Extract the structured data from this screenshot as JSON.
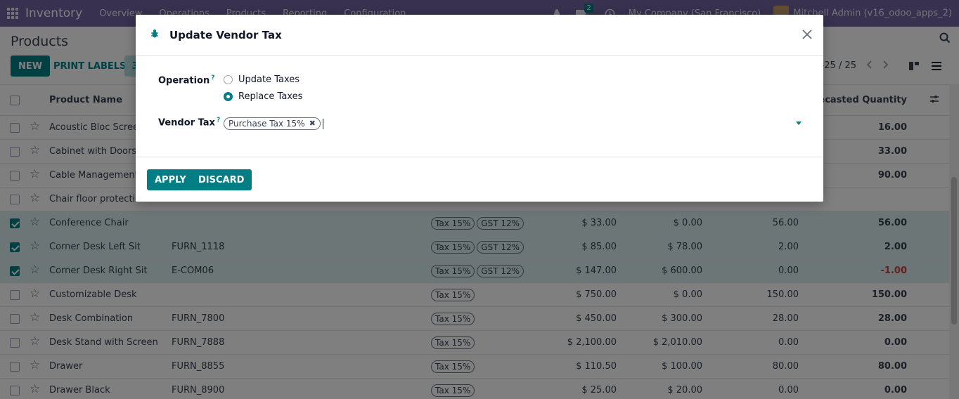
{
  "navbar": {
    "brand": "Inventory",
    "menus": [
      "Overview",
      "Operations",
      "Products",
      "Reporting",
      "Configuration"
    ],
    "chat_count": "2",
    "company": "My Company (San Francisco)",
    "user": "Mitchell Admin (v16_odoo_apps_2)"
  },
  "control_panel": {
    "breadcrumb": "Products",
    "new_label": "NEW",
    "print_labels_label": "PRINT LABELS",
    "selected_count": "3",
    "pager": "-25 / 25"
  },
  "list": {
    "header": {
      "name": "Product Name",
      "forecasted": "Forecasted Quantity"
    },
    "rows": [
      {
        "name": "Acoustic Bloc Screen",
        "ref": "",
        "taxes": [],
        "price": "",
        "cost": "",
        "onhand": "",
        "forecast": "16.00",
        "selected": false
      },
      {
        "name": "Cabinet with Doors",
        "ref": "",
        "taxes": [],
        "price": "",
        "cost": "",
        "onhand": "",
        "forecast": "33.00",
        "selected": false
      },
      {
        "name": "Cable Management B",
        "ref": "",
        "taxes": [],
        "price": "",
        "cost": "",
        "onhand": "",
        "forecast": "90.00",
        "selected": false
      },
      {
        "name": "Chair floor protection",
        "ref": "",
        "taxes": [],
        "price": "",
        "cost": "",
        "onhand": "",
        "forecast": "",
        "selected": false
      },
      {
        "name": "Conference Chair",
        "ref": "",
        "taxes": [
          "Tax 15%",
          "GST 12%"
        ],
        "price": "$ 33.00",
        "cost": "$ 0.00",
        "onhand": "56.00",
        "forecast": "56.00",
        "selected": true
      },
      {
        "name": "Corner Desk Left Sit",
        "ref": "FURN_1118",
        "taxes": [
          "Tax 15%",
          "GST 12%"
        ],
        "price": "$ 85.00",
        "cost": "$ 78.00",
        "onhand": "2.00",
        "forecast": "2.00",
        "selected": true
      },
      {
        "name": "Corner Desk Right Sit",
        "ref": "E-COM06",
        "taxes": [
          "Tax 15%",
          "GST 12%"
        ],
        "price": "$ 147.00",
        "cost": "$ 600.00",
        "onhand": "0.00",
        "forecast": "-1.00",
        "selected": true
      },
      {
        "name": "Customizable Desk",
        "ref": "",
        "taxes": [
          "Tax 15%"
        ],
        "price": "$ 750.00",
        "cost": "$ 0.00",
        "onhand": "150.00",
        "forecast": "150.00",
        "selected": false
      },
      {
        "name": "Desk Combination",
        "ref": "FURN_7800",
        "taxes": [
          "Tax 15%"
        ],
        "price": "$ 450.00",
        "cost": "$ 300.00",
        "onhand": "28.00",
        "forecast": "28.00",
        "selected": false
      },
      {
        "name": "Desk Stand with Screen",
        "ref": "FURN_7888",
        "taxes": [
          "Tax 15%"
        ],
        "price": "$ 2,100.00",
        "cost": "$ 2,010.00",
        "onhand": "0.00",
        "forecast": "0.00",
        "selected": false
      },
      {
        "name": "Drawer",
        "ref": "FURN_8855",
        "taxes": [
          "Tax 15%"
        ],
        "price": "$ 110.50",
        "cost": "$ 100.00",
        "onhand": "80.00",
        "forecast": "80.00",
        "selected": false
      },
      {
        "name": "Drawer Black",
        "ref": "FURN_8900",
        "taxes": [
          "Tax 15%"
        ],
        "price": "$ 25.00",
        "cost": "$ 20.00",
        "onhand": "0.00",
        "forecast": "0.00",
        "selected": false
      }
    ]
  },
  "modal": {
    "title": "Update Vendor Tax",
    "operation_label": "Operation",
    "help_mark": "?",
    "options": [
      {
        "label": "Update Taxes",
        "checked": false
      },
      {
        "label": "Replace Taxes",
        "checked": true
      }
    ],
    "vendor_tax_label": "Vendor Tax",
    "vendor_tax_tags": [
      "Purchase Tax 15%"
    ],
    "apply_label": "APPLY",
    "discard_label": "DISCARD"
  },
  "colors": {
    "navbar": "#71639e",
    "primary": "#017e84",
    "selected_row": "#d8ecee",
    "negative": "#d23f3a"
  }
}
